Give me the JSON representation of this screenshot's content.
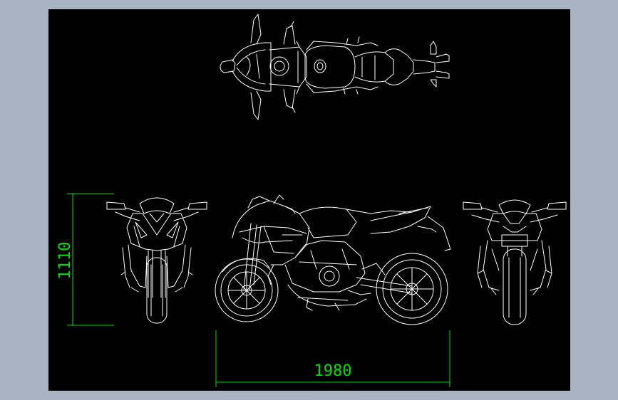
{
  "drawing": {
    "height_dimension": "1110",
    "length_dimension": "1980"
  },
  "colors": {
    "canvas_frame": "#a9b4c2",
    "viewport": "#000000",
    "linework": "#ffffff",
    "dimensions": "#00e000"
  }
}
